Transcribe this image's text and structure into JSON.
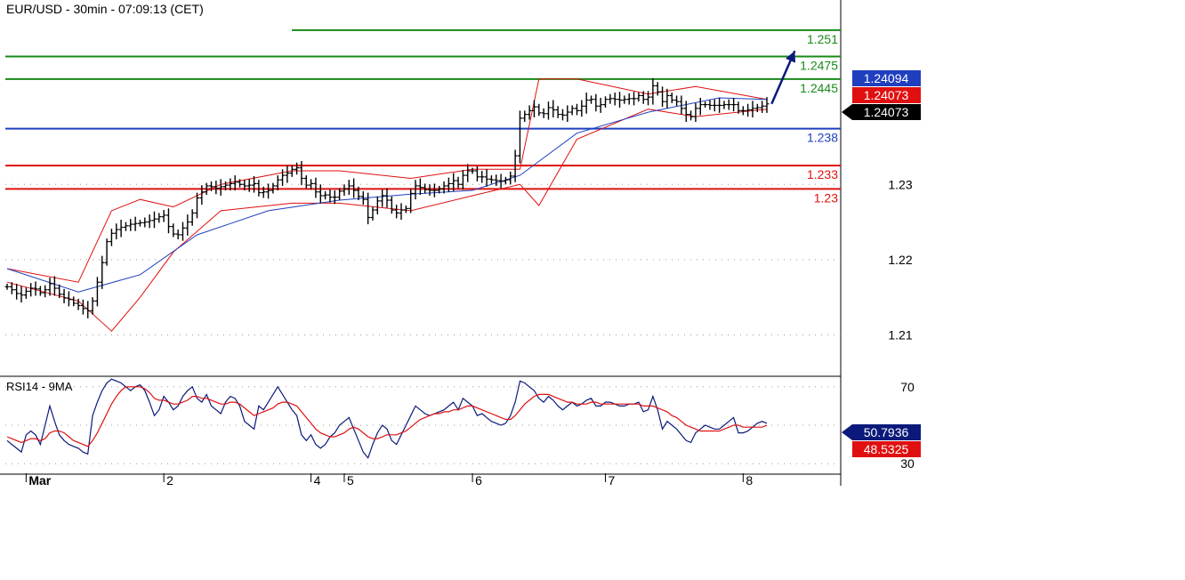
{
  "title": "EUR/USD - 30min - 07:09:13 (CET)",
  "rsi_title": "RSI14 - 9MA",
  "colors": {
    "green": "#1a8a1a",
    "blue": "#1f3fbf",
    "red": "#e01010",
    "navy": "#0b1a7a",
    "black": "#000000",
    "grid": "#9a9a9a",
    "bb": "#e01010",
    "ma": "#1f3fbf",
    "rsi": "#0b1a7a",
    "rsi_ma": "#e01010"
  },
  "chart_data": [
    {
      "type": "line",
      "subtype": "candlestick-ohlc",
      "title": "EUR/USD - 30min - 07:09:13 (CET)",
      "ylim": [
        1.2045,
        1.2545
      ],
      "y_ticks": [
        1.21,
        1.22,
        1.23
      ],
      "x_tick_labels": [
        "Mar",
        "2",
        "4",
        "5",
        "6",
        "7",
        "8"
      ],
      "x_tick_index": [
        4,
        33,
        64,
        71,
        98,
        126,
        155
      ],
      "price_path": [
        1.2164,
        1.216,
        1.2155,
        1.2153,
        1.2158,
        1.2162,
        1.2161,
        1.2156,
        1.216,
        1.2168,
        1.2162,
        1.2154,
        1.2149,
        1.2147,
        1.2142,
        1.2139,
        1.2135,
        1.2132,
        1.2145,
        1.217,
        1.2196,
        1.2224,
        1.2235,
        1.224,
        1.2243,
        1.2245,
        1.2247,
        1.2248,
        1.2249,
        1.225,
        1.2252,
        1.2254,
        1.2257,
        1.2259,
        1.2244,
        1.2234,
        1.2233,
        1.2242,
        1.225,
        1.2262,
        1.2282,
        1.229,
        1.2298,
        1.2297,
        1.2295,
        1.2297,
        1.2299,
        1.2301,
        1.2303,
        1.23,
        1.2298,
        1.2299,
        1.2301,
        1.2289,
        1.229,
        1.2292,
        1.2298,
        1.2306,
        1.2312,
        1.2315,
        1.232,
        1.2322,
        1.2308,
        1.2299,
        1.2301,
        1.229,
        1.2285,
        1.2286,
        1.2283,
        1.2283,
        1.2291,
        1.2294,
        1.2298,
        1.2292,
        1.2284,
        1.228,
        1.2256,
        1.2266,
        1.2278,
        1.2285,
        1.2279,
        1.2266,
        1.2262,
        1.2266,
        1.2268,
        1.2288,
        1.2298,
        1.2296,
        1.2293,
        1.2292,
        1.2292,
        1.2294,
        1.2298,
        1.2301,
        1.2305,
        1.23,
        1.2312,
        1.2318,
        1.2318,
        1.231,
        1.231,
        1.2307,
        1.2306,
        1.2305,
        1.2304,
        1.2306,
        1.2311,
        1.2338,
        1.2388,
        1.2393,
        1.2398,
        1.2403,
        1.2395,
        1.2394,
        1.2402,
        1.2399,
        1.2393,
        1.2392,
        1.2396,
        1.2401,
        1.2398,
        1.2404,
        1.2412,
        1.2413,
        1.2404,
        1.2406,
        1.2413,
        1.2414,
        1.2413,
        1.2412,
        1.2413,
        1.2414,
        1.2414,
        1.2418,
        1.2413,
        1.2416,
        1.2431,
        1.2423,
        1.241,
        1.2418,
        1.2412,
        1.241,
        1.2401,
        1.2393,
        1.239,
        1.2401,
        1.2406,
        1.2406,
        1.2405,
        1.2405,
        1.2405,
        1.2406,
        1.2406,
        1.2406,
        1.2398,
        1.2398,
        1.2399,
        1.2401,
        1.2402,
        1.2404,
        1.2407
      ],
      "moving_average": {
        "x": [
          0,
          15,
          28,
          40,
          55,
          70,
          85,
          98,
          108,
          120,
          135,
          150,
          160
        ],
        "y": [
          1.2188,
          1.2157,
          1.218,
          1.2233,
          1.2265,
          1.2279,
          1.2287,
          1.2292,
          1.2312,
          1.2368,
          1.2396,
          1.2415,
          1.2413
        ]
      },
      "bollinger_upper": {
        "x": [
          0,
          15,
          22,
          28,
          35,
          45,
          60,
          70,
          85,
          98,
          108,
          112,
          120,
          135,
          145,
          160
        ],
        "y": [
          1.2188,
          1.217,
          1.2265,
          1.228,
          1.227,
          1.23,
          1.2318,
          1.2318,
          1.2308,
          1.232,
          1.232,
          1.244,
          1.244,
          1.242,
          1.243,
          1.2413
        ]
      },
      "bollinger_lower": {
        "x": [
          0,
          15,
          22,
          28,
          35,
          45,
          60,
          70,
          85,
          98,
          108,
          112,
          120,
          135,
          145,
          160
        ],
        "y": [
          1.217,
          1.2145,
          1.2105,
          1.215,
          1.221,
          1.2265,
          1.2275,
          1.2275,
          1.2265,
          1.2285,
          1.23,
          1.2272,
          1.236,
          1.24,
          1.239,
          1.24
        ]
      },
      "projection": {
        "from": [
          161,
          1.2407
        ],
        "to": [
          164,
          1.2475
        ]
      },
      "levels": [
        {
          "label": "1.251",
          "value": 1.2505,
          "color": "green"
        },
        {
          "label": "1.2475",
          "value": 1.247,
          "color": "green"
        },
        {
          "label": "1.2445",
          "value": 1.244,
          "color": "green"
        },
        {
          "label": "1.238",
          "value": 1.2374,
          "color": "blue"
        },
        {
          "label": "1.233",
          "value": 1.2325,
          "color": "red"
        },
        {
          "label": "1.23",
          "value": 1.2294,
          "color": "red"
        }
      ],
      "price_tags": [
        {
          "label": "1.24094",
          "value": 1.24094,
          "color": "blue"
        },
        {
          "label": "1.24073",
          "value": 1.24073,
          "color": "red"
        },
        {
          "label": "1.24073",
          "value": 1.24073,
          "color": "black"
        }
      ]
    },
    {
      "type": "line",
      "title": "RSI14 - 9MA",
      "ylim": [
        25,
        75
      ],
      "y_ticks": [
        30,
        70
      ],
      "series": [
        {
          "name": "RSI14",
          "color": "rsi",
          "values": [
            42,
            40,
            38,
            36,
            45,
            47,
            45,
            40,
            50,
            60,
            52,
            45,
            42,
            40,
            39,
            38,
            36,
            35,
            55,
            62,
            68,
            72,
            74,
            73,
            72,
            70,
            68,
            70,
            71,
            68,
            62,
            55,
            58,
            65,
            62,
            58,
            60,
            65,
            68,
            70,
            64,
            62,
            66,
            60,
            58,
            56,
            62,
            65,
            64,
            60,
            52,
            50,
            48,
            60,
            58,
            62,
            66,
            70,
            66,
            62,
            58,
            55,
            45,
            42,
            45,
            40,
            38,
            40,
            44,
            46,
            50,
            52,
            54,
            48,
            42,
            36,
            33,
            40,
            46,
            50,
            48,
            42,
            40,
            45,
            50,
            55,
            60,
            58,
            56,
            55,
            56,
            57,
            58,
            60,
            62,
            58,
            64,
            62,
            60,
            55,
            56,
            54,
            52,
            51,
            50,
            51,
            55,
            62,
            73,
            72,
            70,
            68,
            64,
            62,
            65,
            63,
            60,
            58,
            60,
            62,
            60,
            61,
            63,
            64,
            60,
            60,
            62,
            62,
            61,
            60,
            60,
            61,
            61,
            62,
            57,
            58,
            65,
            58,
            48,
            52,
            50,
            48,
            45,
            42,
            41,
            46,
            48,
            50,
            49,
            48,
            48,
            50,
            52,
            54,
            46,
            46,
            47,
            49,
            51,
            52,
            51
          ]
        },
        {
          "name": "9MA",
          "color": "rsi_ma",
          "values": [
            44,
            43,
            42,
            41,
            42,
            43,
            43,
            42,
            43,
            46,
            47,
            47,
            46,
            44,
            42,
            41,
            40,
            39,
            42,
            46,
            51,
            56,
            61,
            65,
            68,
            70,
            70,
            70,
            70,
            69,
            67,
            64,
            63,
            63,
            62,
            61,
            61,
            62,
            63,
            65,
            65,
            64,
            64,
            63,
            62,
            61,
            61,
            62,
            62,
            61,
            59,
            57,
            55,
            56,
            57,
            58,
            59,
            61,
            62,
            62,
            61,
            60,
            57,
            54,
            51,
            48,
            46,
            45,
            44,
            44,
            45,
            46,
            48,
            49,
            48,
            46,
            44,
            43,
            43,
            44,
            45,
            45,
            45,
            46,
            47,
            49,
            51,
            53,
            54,
            55,
            56,
            56,
            57,
            57,
            58,
            58,
            59,
            60,
            60,
            59,
            58,
            57,
            56,
            55,
            54,
            53,
            53,
            55,
            58,
            61,
            63,
            65,
            66,
            66,
            66,
            65,
            64,
            63,
            62,
            62,
            61,
            61,
            61,
            62,
            62,
            61,
            61,
            61,
            61,
            61,
            61,
            61,
            61,
            61,
            60,
            60,
            60,
            59,
            58,
            57,
            55,
            54,
            52,
            50,
            49,
            48,
            47,
            47,
            47,
            47,
            47,
            48,
            49,
            50,
            50,
            49,
            49,
            49,
            49,
            49,
            50
          ]
        }
      ],
      "value_tags": [
        {
          "label": "50.7936",
          "value": 50.7936,
          "color": "navy"
        },
        {
          "label": "48.5325",
          "value": 48.5325,
          "color": "red"
        }
      ]
    }
  ]
}
